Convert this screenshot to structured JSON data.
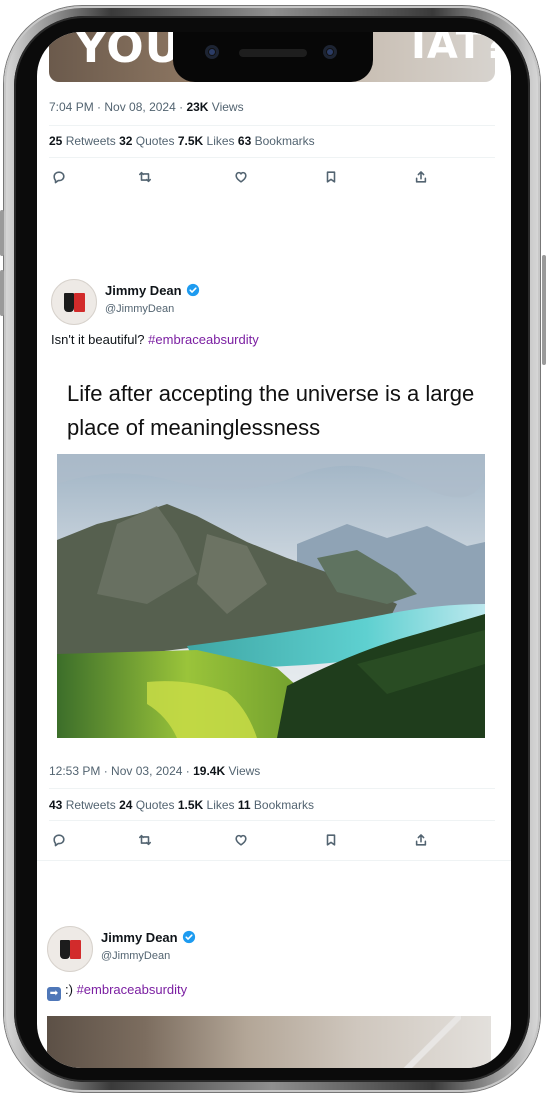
{
  "top_tweet": {
    "media_text_left": "YOU",
    "media_text_right": "IAT?",
    "time": "7:04 PM",
    "date": "Nov 08, 2024",
    "views_count": "23K",
    "views_label": "Views",
    "retweets_count": "25",
    "retweets_label": "Retweets",
    "quotes_count": "32",
    "quotes_label": "Quotes",
    "likes_count": "7.5K",
    "likes_label": "Likes",
    "bookmarks_count": "63",
    "bookmarks_label": "Bookmarks"
  },
  "tweet": {
    "author_name": "Jimmy Dean",
    "author_handle": "@JimmyDean",
    "text": "Isn't it beautiful?",
    "hashtag": "#embraceabsurdity",
    "image_caption": "Life after accepting the universe is a large place of meaninglessness",
    "time": "12:53 PM",
    "date": "Nov 03, 2024",
    "views_count": "19.4K",
    "views_label": "Views",
    "retweets_count": "43",
    "retweets_label": "Retweets",
    "quotes_count": "24",
    "quotes_label": "Quotes",
    "likes_count": "1.5K",
    "likes_label": "Likes",
    "bookmarks_count": "11",
    "bookmarks_label": "Bookmarks"
  },
  "next_tweet": {
    "author_name": "Jimmy Dean",
    "author_handle": "@JimmyDean",
    "text": ":)",
    "hashtag": "#embraceabsurdity"
  },
  "icons": [
    "reply-icon",
    "retweet-icon",
    "like-icon",
    "bookmark-icon",
    "share-icon",
    "verified-badge-icon"
  ],
  "colors": {
    "hashtag": "#7b1fa2",
    "verified": "#1d9bf0",
    "muted_text": "#536471"
  }
}
